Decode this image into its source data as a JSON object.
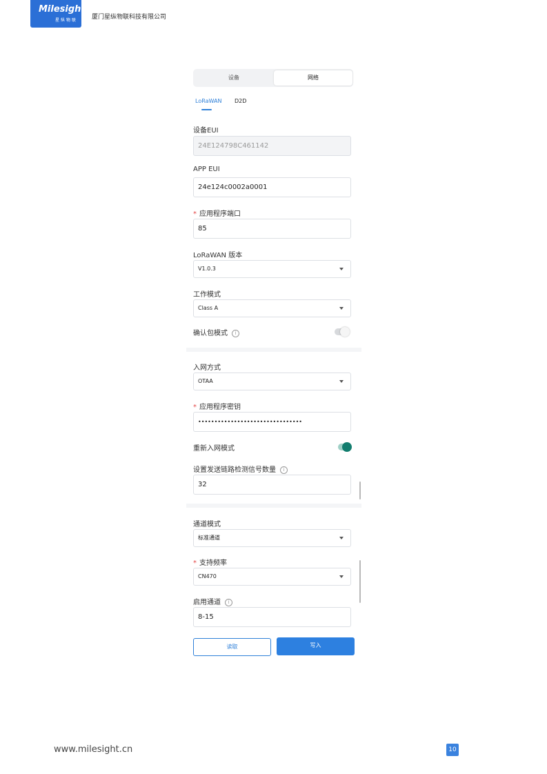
{
  "header": {
    "brand": "Milesight",
    "brand_sub": "星纵物联",
    "company": "厦门星纵物联科技有限公司"
  },
  "tabs": {
    "device": "设备",
    "network": "网络"
  },
  "subtabs": {
    "lorawan": "LoRaWAN",
    "d2d": "D2D"
  },
  "fields": {
    "device_eui": {
      "label": "设备EUI",
      "value": "24E124798C461142"
    },
    "app_eui": {
      "label": "APP EUI",
      "value": "24e124c0002a0001"
    },
    "app_port": {
      "label": "应用程序端口",
      "value": "85"
    },
    "lorawan_version": {
      "label": "LoRaWAN 版本",
      "value": "V1.0.3"
    },
    "work_mode": {
      "label": "工作模式",
      "value": "Class A"
    },
    "confirm_mode": {
      "label": "确认包模式"
    },
    "join_type": {
      "label": "入网方式",
      "value": "OTAA"
    },
    "app_key": {
      "label": "应用程序密钥",
      "value": "••••••••••••••••••••••••••••••••"
    },
    "rejoin_mode": {
      "label": "重新入网模式"
    },
    "link_check": {
      "label": "设置发送链路检测信号数量",
      "value": "32"
    },
    "channel_mode": {
      "label": "通道模式",
      "value": "标准通道"
    },
    "freq": {
      "label": "支持频率",
      "value": "CN470"
    },
    "enable_channel": {
      "label": "启用通道",
      "value": "8-15"
    }
  },
  "info_glyph": "i",
  "required_mark": "*",
  "buttons": {
    "read": "读取",
    "write": "写入"
  },
  "toggles": {
    "confirm_mode_on": false,
    "rejoin_mode_on": true
  },
  "footer": {
    "url": "www.milesight.cn",
    "page": "10"
  },
  "colors": {
    "accent": "#2d7fd8",
    "toggle_on": "#127d6e",
    "required": "#e34848"
  }
}
